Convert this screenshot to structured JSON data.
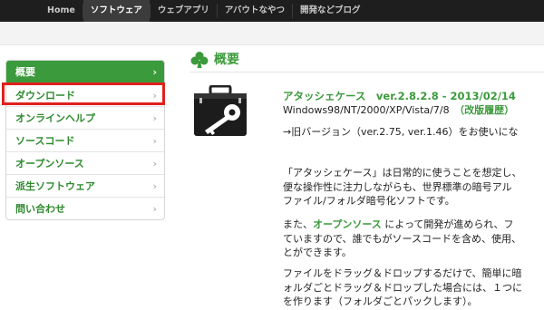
{
  "topnav": {
    "items": [
      "Home",
      "ソフトウェア",
      "ウェブアプリ",
      "アバウトなやつ",
      "開発などブログ"
    ],
    "active_index": 1
  },
  "sidebar": {
    "items": [
      {
        "label": "概要",
        "active": true
      },
      {
        "label": "ダウンロード",
        "highlighted": true
      },
      {
        "label": "オンラインヘルプ"
      },
      {
        "label": "ソースコード"
      },
      {
        "label": "オープンソース"
      },
      {
        "label": "派生ソフトウェア"
      },
      {
        "label": "問い合わせ"
      }
    ],
    "chevron": "›"
  },
  "main": {
    "title": "概要",
    "title_icon": "club-icon",
    "app_icon": "briefcase-key-icon",
    "app_title": "アタッシェケース　ver.2.8.2.8 - 2013/02/14",
    "os_text": "Windows98/NT/2000/XP/Vista/7/8　",
    "history_link": "（改版履歴）",
    "old_versions": "→旧バージョン（ver.2.75, ver.1.46）をお使いにな",
    "para1": [
      "「アタッシェケース」は日常的に使うことを想定し、",
      "便な操作性に注力しながらも、世界標準の暗号アル",
      "ファイル/フォルダ暗号化ソフトです。"
    ],
    "para2_prefix": "また、",
    "para2_link": "オープンソース",
    "para2_rest": "によって開発が進められ、フ",
    "para2_lines": [
      "ていますので、誰でもがソースコードを含め、使用、",
      "とができます。"
    ],
    "para3": [
      "ファイルをドラッグ＆ドロップするだけで、簡単に暗",
      "ォルダごとドラッグ＆ドロップした場合には、１つに",
      "を作ります（フォルダごとパックします）。"
    ]
  },
  "colors": {
    "accent_green": "#3b9a3b",
    "nav_bg": "#1e1e1e",
    "highlight_red": "#e0201e"
  }
}
